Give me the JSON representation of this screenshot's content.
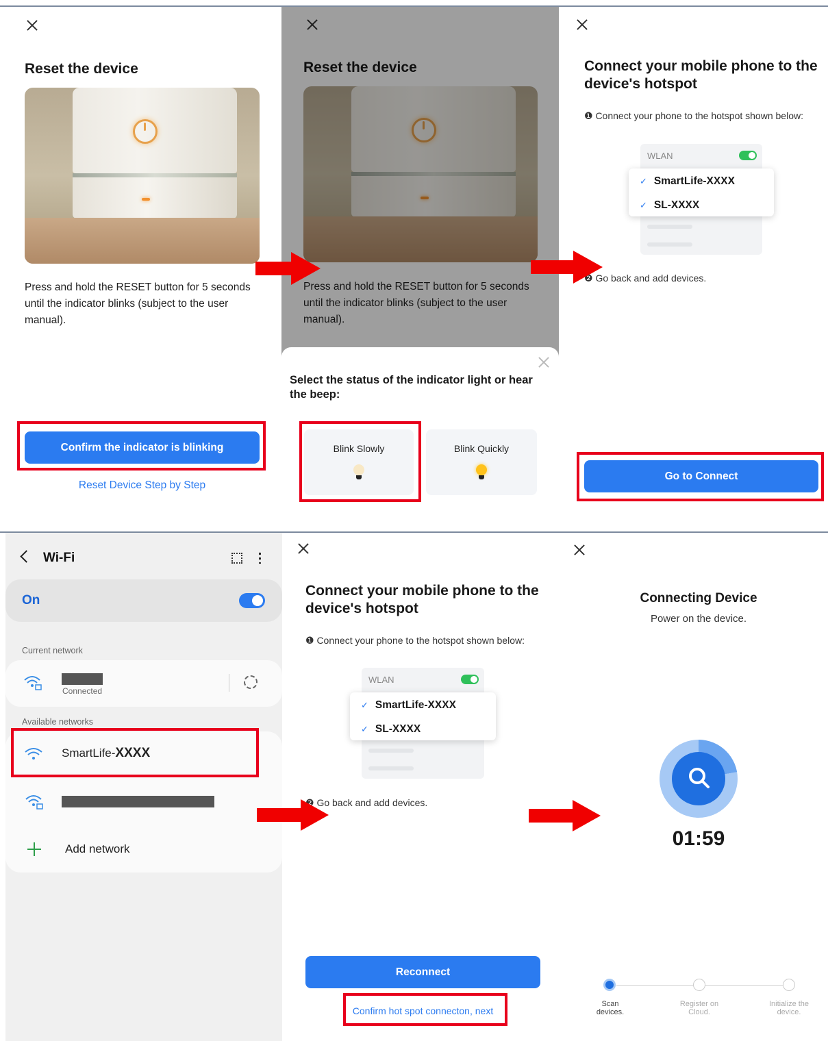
{
  "screen1": {
    "title": "Reset the device",
    "description": "Press and hold the RESET button for 5 seconds until the indicator blinks (subject to the user manual).",
    "confirm_button": "Confirm the indicator is blinking",
    "reset_link": "Reset Device Step by Step"
  },
  "screen2": {
    "title": "Reset the device",
    "description": "Press and hold the RESET button for 5 seconds until the indicator blinks (subject to the user manual).",
    "sheet_title": "Select the status of the indicator light or hear the beep:",
    "options": [
      "Blink Slowly",
      "Blink Quickly"
    ]
  },
  "screen3": {
    "title": "Connect your mobile phone to the device's hotspot",
    "step1": "❶ Connect your phone to the hotspot shown below:",
    "wlan_label": "WLAN",
    "networks": [
      "SmartLife-XXXX",
      "SL-XXXX"
    ],
    "step2": "❷ Go back and add devices.",
    "connect_button": "Go to Connect"
  },
  "screen4": {
    "header": "Wi-Fi",
    "on_label": "On",
    "current_network_label": "Current network",
    "connected_label": "Connected",
    "available_label": "Available networks",
    "smartlife_prefix": "SmartLife-",
    "smartlife_suffix": "XXXX",
    "add_network": "Add network"
  },
  "screen5": {
    "title": "Connect your mobile phone to the device's hotspot",
    "step1": "❶ Connect your phone to the hotspot shown below:",
    "wlan_label": "WLAN",
    "networks": [
      "SmartLife-XXXX",
      "SL-XXXX"
    ],
    "step2": "❷ Go back and add devices.",
    "reconnect_button": "Reconnect",
    "confirm_link": "Confirm hot spot connecton, next"
  },
  "screen6": {
    "title": "Connecting Device",
    "subtitle": "Power on the device.",
    "timer": "01:59",
    "steps": [
      {
        "line1": "Scan",
        "line2": "devices."
      },
      {
        "line1": "Register on",
        "line2": "Cloud."
      },
      {
        "line1": "Initialize the",
        "line2": "device."
      }
    ]
  },
  "colors": {
    "accent_blue": "#2b7bf0",
    "highlight_red": "#e8001c",
    "toggle_green": "#2fc05a"
  }
}
